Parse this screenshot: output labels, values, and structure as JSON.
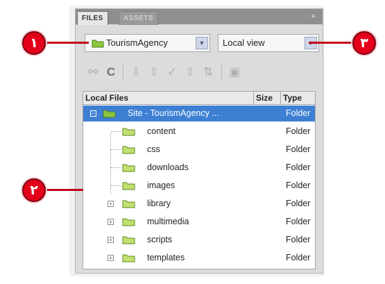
{
  "panel": {
    "tabs": [
      {
        "label": "FILES"
      },
      {
        "label": "ASSETS"
      }
    ],
    "site_select": {
      "value": "TourismAgency"
    },
    "view_select": {
      "value": "Local view"
    }
  },
  "filelist": {
    "columns": {
      "name": "Local Files",
      "size": "Size",
      "type": "Type"
    },
    "rows": [
      {
        "name": "Site - TourismAgency ...",
        "type": "Folder",
        "selected": true,
        "expander": "−"
      },
      {
        "name": "content",
        "type": "Folder"
      },
      {
        "name": "css",
        "type": "Folder"
      },
      {
        "name": "downloads",
        "type": "Folder"
      },
      {
        "name": "images",
        "type": "Folder"
      },
      {
        "name": "library",
        "type": "Folder",
        "expander": "+"
      },
      {
        "name": "multimedia",
        "type": "Folder",
        "expander": "+"
      },
      {
        "name": "scripts",
        "type": "Folder",
        "expander": "+"
      },
      {
        "name": "templates",
        "type": "Folder",
        "expander": "+"
      }
    ]
  },
  "callouts": {
    "c1": "١",
    "c2": "٢",
    "c3": "٣"
  },
  "colors": {
    "callout": "#e4001b",
    "selection": "#3d7fd3",
    "folder": "#8cc63f"
  },
  "icons": [
    "folder-icon",
    "connect-icon",
    "refresh-icon",
    "get-files-icon",
    "put-files-icon",
    "check-out-icon",
    "check-in-icon",
    "synchronize-icon",
    "expand-icon"
  ]
}
